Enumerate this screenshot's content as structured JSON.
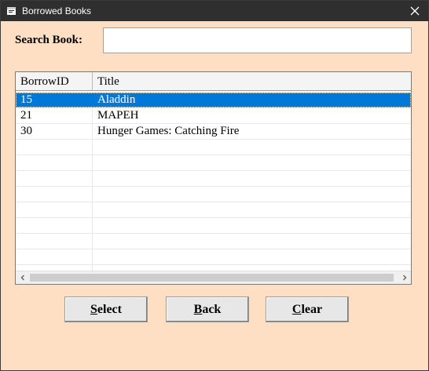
{
  "window": {
    "title": "Borrowed Books",
    "icon": "app-window-icon",
    "close_icon": "close-icon"
  },
  "search": {
    "label": "Search Book:",
    "value": "",
    "placeholder": ""
  },
  "grid": {
    "columns": [
      "BorrowID",
      "Title"
    ],
    "rows": [
      {
        "id": "15",
        "title": "Aladdin",
        "selected": true
      },
      {
        "id": "21",
        "title": "MAPEH",
        "selected": false
      },
      {
        "id": "30",
        "title": "Hunger Games: Catching Fire",
        "selected": false
      }
    ],
    "empty_rows": 9,
    "selection_color": "#0078d7"
  },
  "buttons": {
    "select": {
      "first": "S",
      "rest": "elect"
    },
    "back": {
      "first": "B",
      "rest": "ack"
    },
    "clear": {
      "first": "C",
      "rest": "lear"
    }
  },
  "colors": {
    "form_background": "#ffdfc4",
    "titlebar": "#2f2f2f"
  }
}
